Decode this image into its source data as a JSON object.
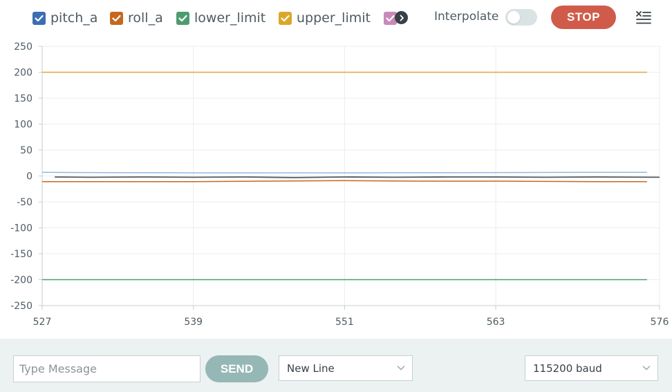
{
  "legend": [
    {
      "label": "pitch_a",
      "color": "#3c6eb4",
      "checked": true
    },
    {
      "label": "roll_a",
      "color": "#c5671f",
      "checked": true
    },
    {
      "label": "lower_limit",
      "color": "#4c9d6e",
      "checked": true
    },
    {
      "label": "upper_limit",
      "color": "#dba72a",
      "checked": true
    }
  ],
  "overflow_checkbox_color": "#c88ab8",
  "interpolate": {
    "label": "Interpolate",
    "enabled": false
  },
  "stop_label": "STOP",
  "chart_data": {
    "type": "line",
    "y_ticks": [
      "250",
      "200",
      "150",
      "100",
      "50",
      "0",
      "-50",
      "-100",
      "-150",
      "-200",
      "-250"
    ],
    "x_ticks": [
      "527",
      "539",
      "551",
      "563",
      "576"
    ],
    "ylim": [
      -250,
      250
    ],
    "xlim": [
      527,
      576
    ],
    "series": [
      {
        "name": "upper_limit",
        "color": "#e5a23a",
        "x": [
          527,
          575
        ],
        "y": [
          200,
          200
        ]
      },
      {
        "name": "lower_limit",
        "color": "#4c9d6e",
        "x": [
          527,
          575
        ],
        "y": [
          -200,
          -200
        ]
      },
      {
        "color": "#8cbce6",
        "x": [
          527,
          531,
          539,
          551,
          563,
          571,
          575
        ],
        "y": [
          7,
          6.5,
          6,
          6,
          6.5,
          7,
          7
        ]
      },
      {
        "color": "#c5671f",
        "x": [
          527,
          531,
          539,
          545,
          551,
          557,
          563,
          571,
          575
        ],
        "y": [
          -11,
          -11,
          -11,
          -10,
          -9,
          -10,
          -10,
          -11,
          -11
        ]
      },
      {
        "color": "#555b5f",
        "x": [
          528,
          531,
          535,
          539,
          543,
          547,
          551,
          555,
          559,
          563,
          567,
          571,
          576
        ],
        "y": [
          -2,
          -2.5,
          -2,
          -2.5,
          -2,
          -3,
          -2,
          -2.5,
          -2,
          -2,
          -2.5,
          -2,
          -2.5
        ]
      }
    ]
  },
  "message_input": {
    "placeholder": "Type Message",
    "value": ""
  },
  "send_label": "SEND",
  "line_ending": "New Line",
  "baud_rate": "115200 baud"
}
